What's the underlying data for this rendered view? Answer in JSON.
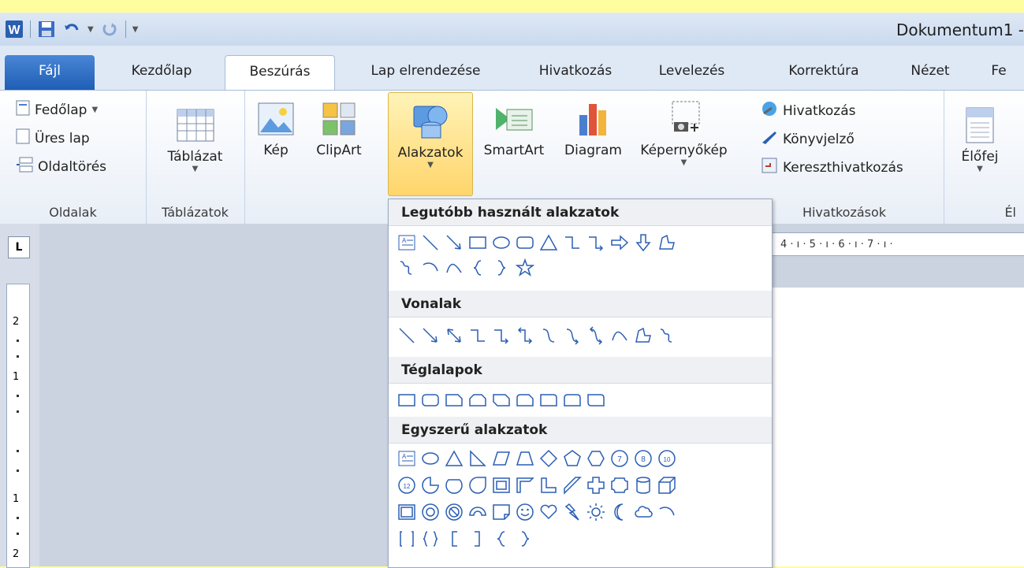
{
  "window": {
    "title": "Dokumentum1 -"
  },
  "tabs": [
    {
      "label": "Fájl"
    },
    {
      "label": "Kezdőlap"
    },
    {
      "label": "Beszúrás"
    },
    {
      "label": "Lap elrendezése"
    },
    {
      "label": "Hivatkozás"
    },
    {
      "label": "Levelezés"
    },
    {
      "label": "Korrektúra"
    },
    {
      "label": "Nézet"
    },
    {
      "label": "Fe"
    }
  ],
  "ribbon": {
    "pages": {
      "label": "Oldalak",
      "cover": "Fedőlap",
      "blank": "Üres lap",
      "break": "Oldaltörés"
    },
    "tables": {
      "label": "Táblázatok",
      "table": "Táblázat"
    },
    "illustrations": {
      "picture": "Kép",
      "clipart": "ClipArt",
      "shapes": "Alakzatok",
      "smartart": "SmartArt",
      "chart": "Diagram",
      "screenshot": "Képernyőkép"
    },
    "links": {
      "label": "Hivatkozások",
      "hyperlink": "Hivatkozás",
      "bookmark": "Könyvjelző",
      "crossref": "Kereszthivatkozás"
    },
    "header": {
      "label": "Él",
      "header": "Élőfej"
    }
  },
  "dropdown": {
    "sections": [
      {
        "title": "Legutóbb használt alakzatok"
      },
      {
        "title": "Vonalak"
      },
      {
        "title": "Téglalapok"
      },
      {
        "title": "Egyszerű alakzatok"
      }
    ]
  },
  "ruler": {
    "h": "4 · ı · 5 · ı · 6 · ı · 7 · ı ·",
    "v1": "2",
    "v2": "1",
    "v3": "1",
    "v4": "2"
  },
  "colors": {
    "accent": "#1e5eb5",
    "background": "#fefe9e",
    "selection": "#ffd56b"
  }
}
